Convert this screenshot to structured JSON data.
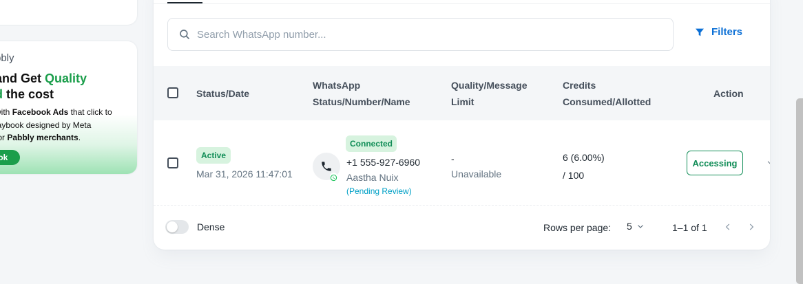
{
  "promo": {
    "brand": "bbly",
    "headline_a": "and Get ",
    "headline_quality": "Quality",
    "headline_b_green": "d",
    "headline_b": " the cost",
    "desc_a": "with ",
    "desc_fb": "Facebook Ads",
    "desc_b": " that click to",
    "desc_c": "laybook designed by Meta",
    "desc_d": " for ",
    "desc_pabbly": "Pabbly merchants",
    "desc_e": ".",
    "cta": "ook"
  },
  "search": {
    "placeholder": "Search WhatsApp number..."
  },
  "filters": {
    "label": "Filters"
  },
  "table": {
    "headers": {
      "status_date": "Status/Date",
      "wa_line1": "WhatsApp",
      "wa_line2": "Status/Number/Name",
      "ql_line1": "Quality/Message",
      "ql_line2": "Limit",
      "cr_line1": "Credits",
      "cr_line2": "Consumed/Allotted",
      "action": "Action"
    },
    "rows": [
      {
        "status": "Active",
        "date": "Mar 31, 2026 11:47:01",
        "wa_status": "Connected",
        "number": "+1 555-927-6960",
        "name": "Aastha Nuix",
        "review": "(Pending Review)",
        "quality": "-",
        "limit": "Unavailable",
        "consumed": "6 (6.00%)",
        "allotted": "/ 100",
        "action": "Accessing"
      }
    ]
  },
  "footer": {
    "dense_label": "Dense",
    "rows_per_page_label": "Rows per page:",
    "rows_per_page_value": "5",
    "range": "1–1 of 1"
  },
  "colors": {
    "accent_blue": "#0b6fd5",
    "success_green": "#118d57",
    "promo_green": "#1b9e4b"
  }
}
